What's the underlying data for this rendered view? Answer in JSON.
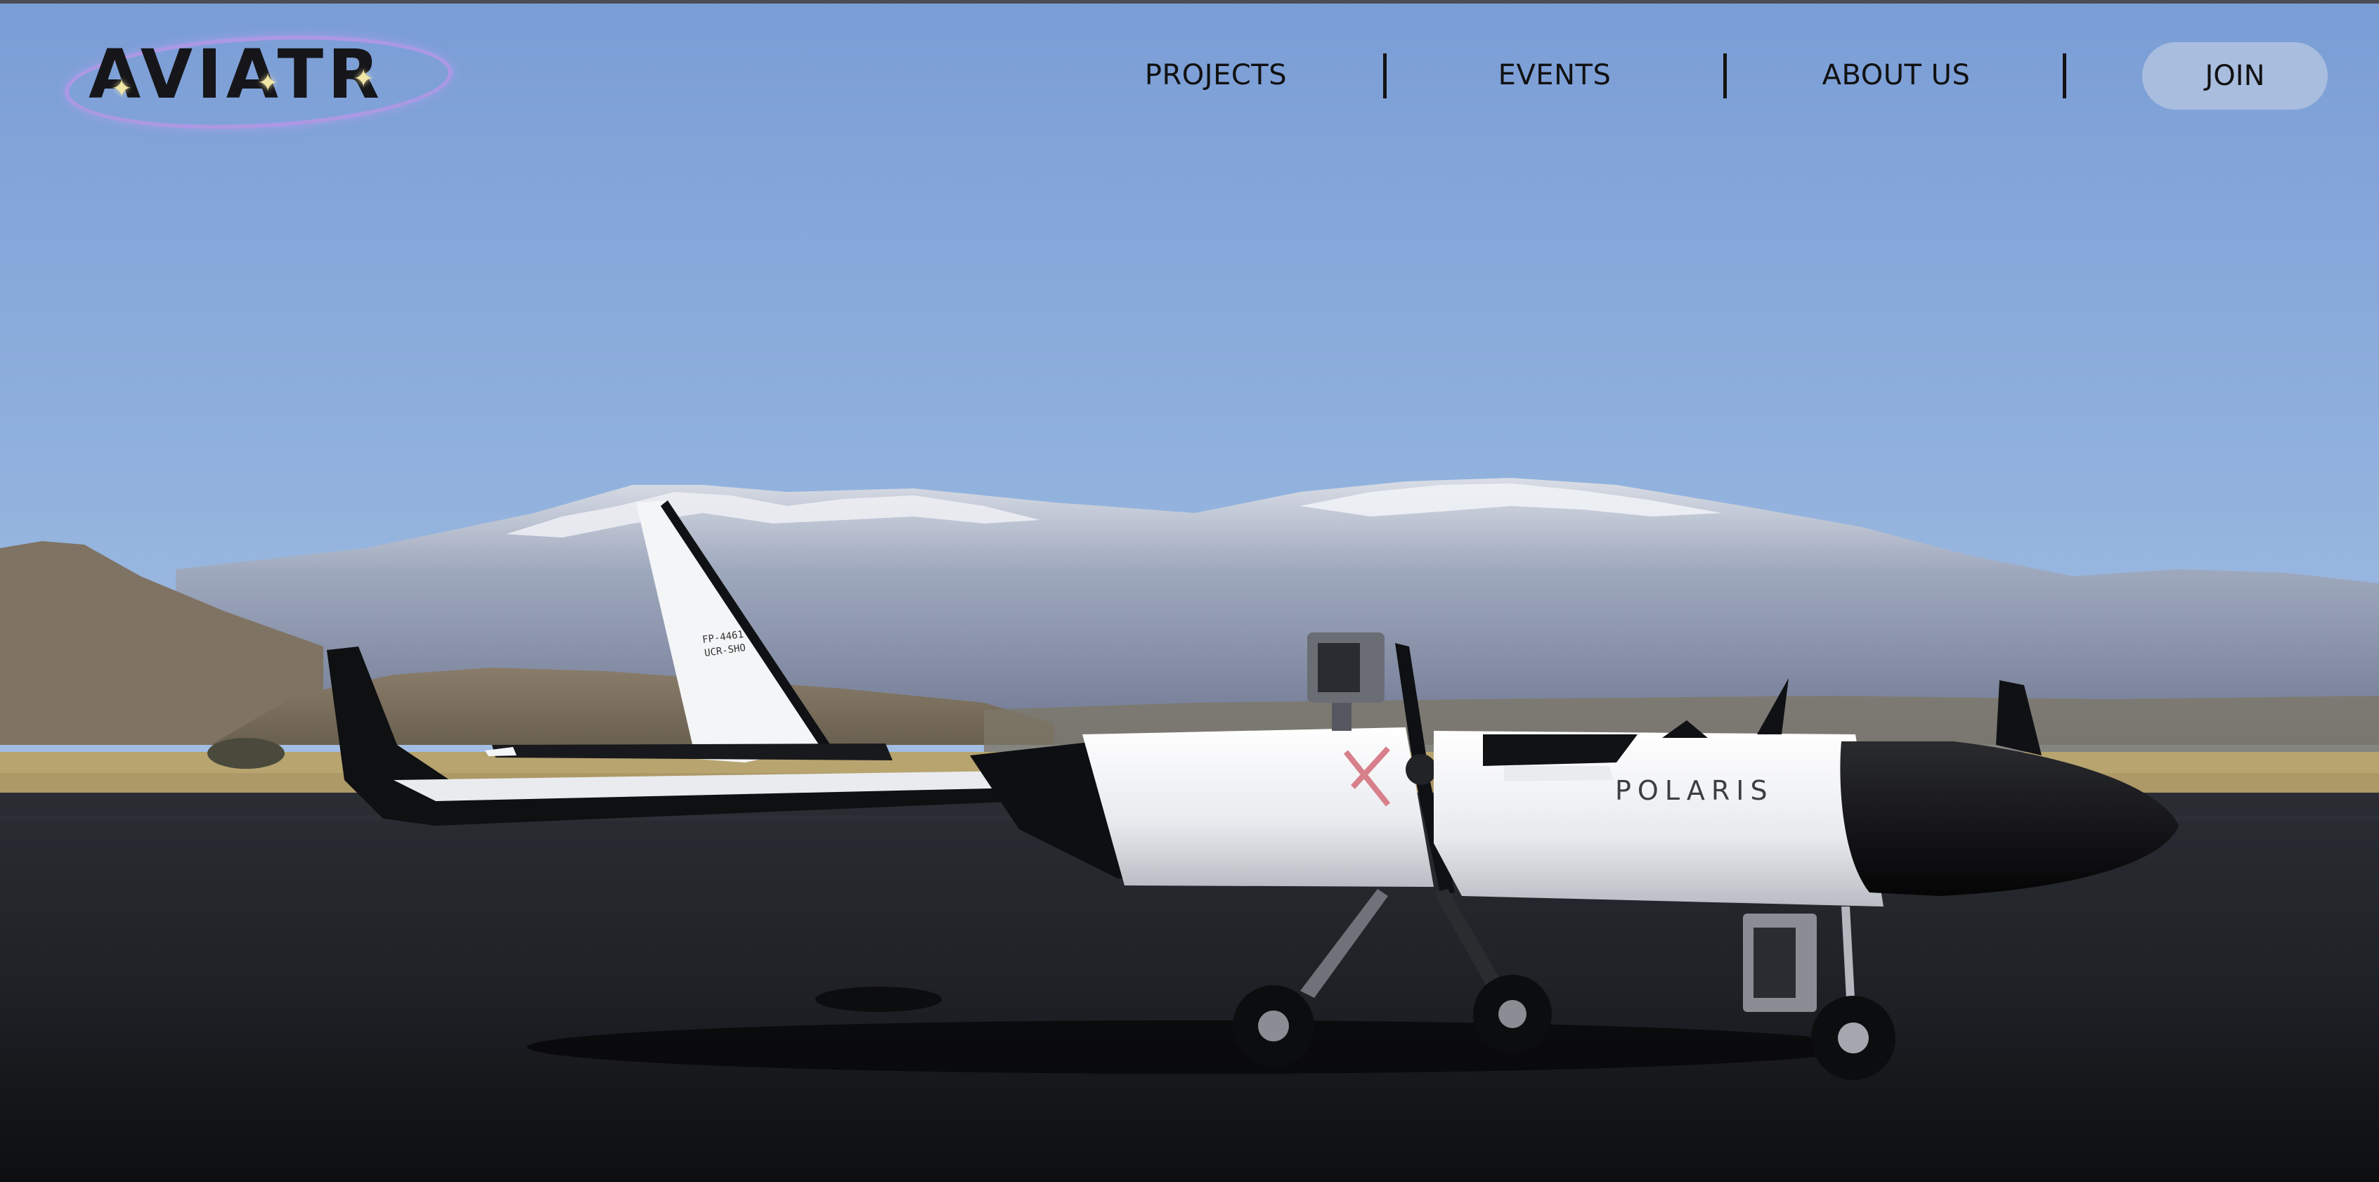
{
  "brand": {
    "logo_text": "AVIATR",
    "logo_icon": "sparkle-star-icon"
  },
  "nav": {
    "items": [
      {
        "label": "PROJECTS"
      },
      {
        "label": "EVENTS"
      },
      {
        "label": "ABOUT US"
      }
    ],
    "join_label": "JOIN"
  },
  "hero": {
    "aircraft_name": "POLARIS",
    "tail_marking_1": "FP-4461",
    "tail_marking_2": "UCR-SHO",
    "scene": "white-and-black-drone-aircraft-on-runway-with-snowy-mountains"
  },
  "colors": {
    "sky_top": "#7a9ed8",
    "sky_bottom": "#8fb0dc",
    "join_button": "#a9bddf",
    "logo_ring": "#b496e6",
    "runway": "#1b1d22"
  }
}
